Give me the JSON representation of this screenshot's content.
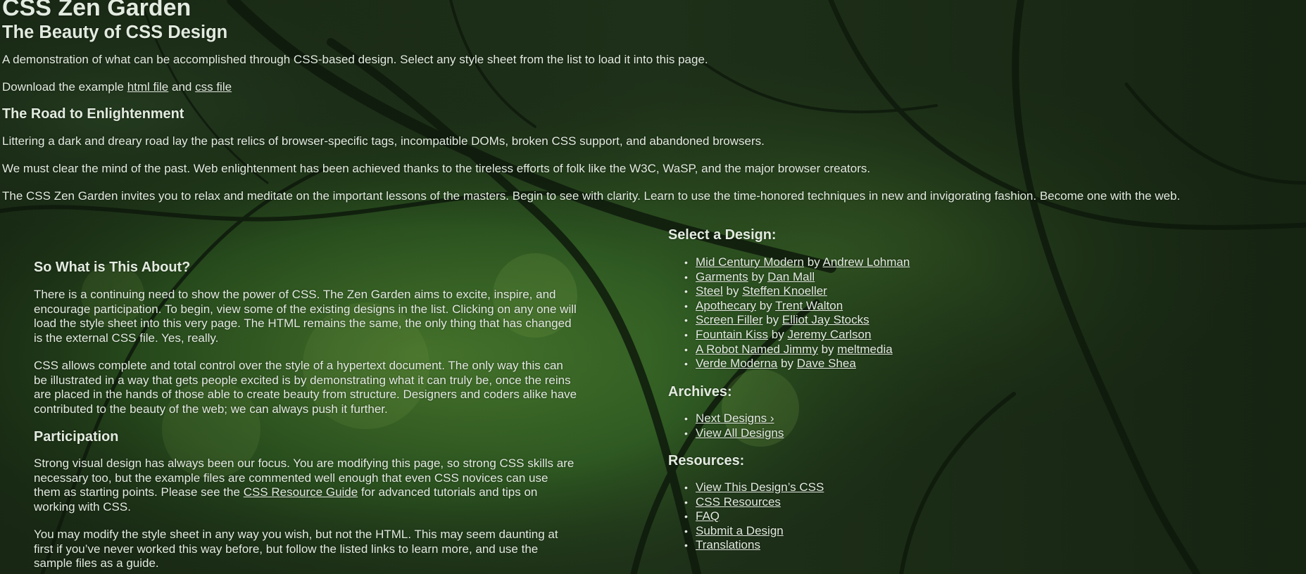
{
  "header": {
    "site_title": "CSS Zen Garden",
    "tagline": "The Beauty of CSS Design"
  },
  "intro": {
    "summary": "A demonstration of what can be accomplished through CSS-based design. Select any style sheet from the list to load it into this page.",
    "download_prefix": "Download the example",
    "html_link": "html file",
    "download_and": "and",
    "css_link": "css file"
  },
  "preamble": {
    "heading": "The Road to Enlightenment",
    "p1": "Littering a dark and dreary road lay the past relics of browser-specific tags, incompatible DOMs, broken CSS support, and abandoned browsers.",
    "p2": "We must clear the mind of the past. Web enlightenment has been achieved thanks to the tireless efforts of folk like the W3C, WaSP, and the major browser creators.",
    "p3": "The CSS Zen Garden invites you to relax and meditate on the important lessons of the masters. Begin to see with clarity. Learn to use the time-honored techniques in new and invigorating fashion. Become one with the web."
  },
  "main": {
    "about_heading": "So What is This About?",
    "about_p1": "There is a continuing need to show the power of CSS. The Zen Garden aims to excite, inspire, and encourage participation. To begin, view some of the existing designs in the list. Clicking on any one will load the style sheet into this very page. The HTML remains the same, the only thing that has changed is the external CSS file. Yes, really.",
    "about_p2": "CSS allows complete and total control over the style of a hypertext document. The only way this can be illustrated in a way that gets people excited is by demonstrating what it can truly be, once the reins are placed in the hands of those able to create beauty from structure. Designers and coders alike have contributed to the beauty of the web; we can always push it further.",
    "participation_heading": "Participation",
    "part_p1_a": "Strong visual design has always been our focus. You are modifying this page, so strong CSS skills are necessary too, but the example files are commented well enough that even CSS novices can use them as starting points. Please see the",
    "part_p1_link": "CSS Resource Guide",
    "part_p1_b": "for advanced tutorials and tips on working with CSS.",
    "part_p2": "You may modify the style sheet in any way you wish, but not the HTML. This may seem daunting at first if you’ve never worked this way before, but follow the listed links to learn more, and use the sample files as a guide."
  },
  "sidebar": {
    "select_heading": "Select a Design:",
    "by": "by",
    "designs": [
      {
        "name": "Mid Century Modern",
        "author": "Andrew Lohman"
      },
      {
        "name": "Garments",
        "author": "Dan Mall"
      },
      {
        "name": "Steel",
        "author": "Steffen Knoeller"
      },
      {
        "name": "Apothecary",
        "author": "Trent Walton"
      },
      {
        "name": "Screen Filler",
        "author": "Elliot Jay Stocks"
      },
      {
        "name": "Fountain Kiss",
        "author": "Jeremy Carlson"
      },
      {
        "name": "A Robot Named Jimmy",
        "author": "meltmedia"
      },
      {
        "name": "Verde Moderna",
        "author": "Dave Shea"
      }
    ],
    "archives_heading": "Archives:",
    "archives": [
      "Next Designs ›",
      "View All Designs"
    ],
    "resources_heading": "Resources:",
    "resources": [
      "View This Design’s CSS",
      "CSS Resources",
      "FAQ",
      "Submit a Design",
      "Translations"
    ]
  },
  "colors": {
    "text": "#e3ebe0",
    "background": "#1b2b16"
  }
}
